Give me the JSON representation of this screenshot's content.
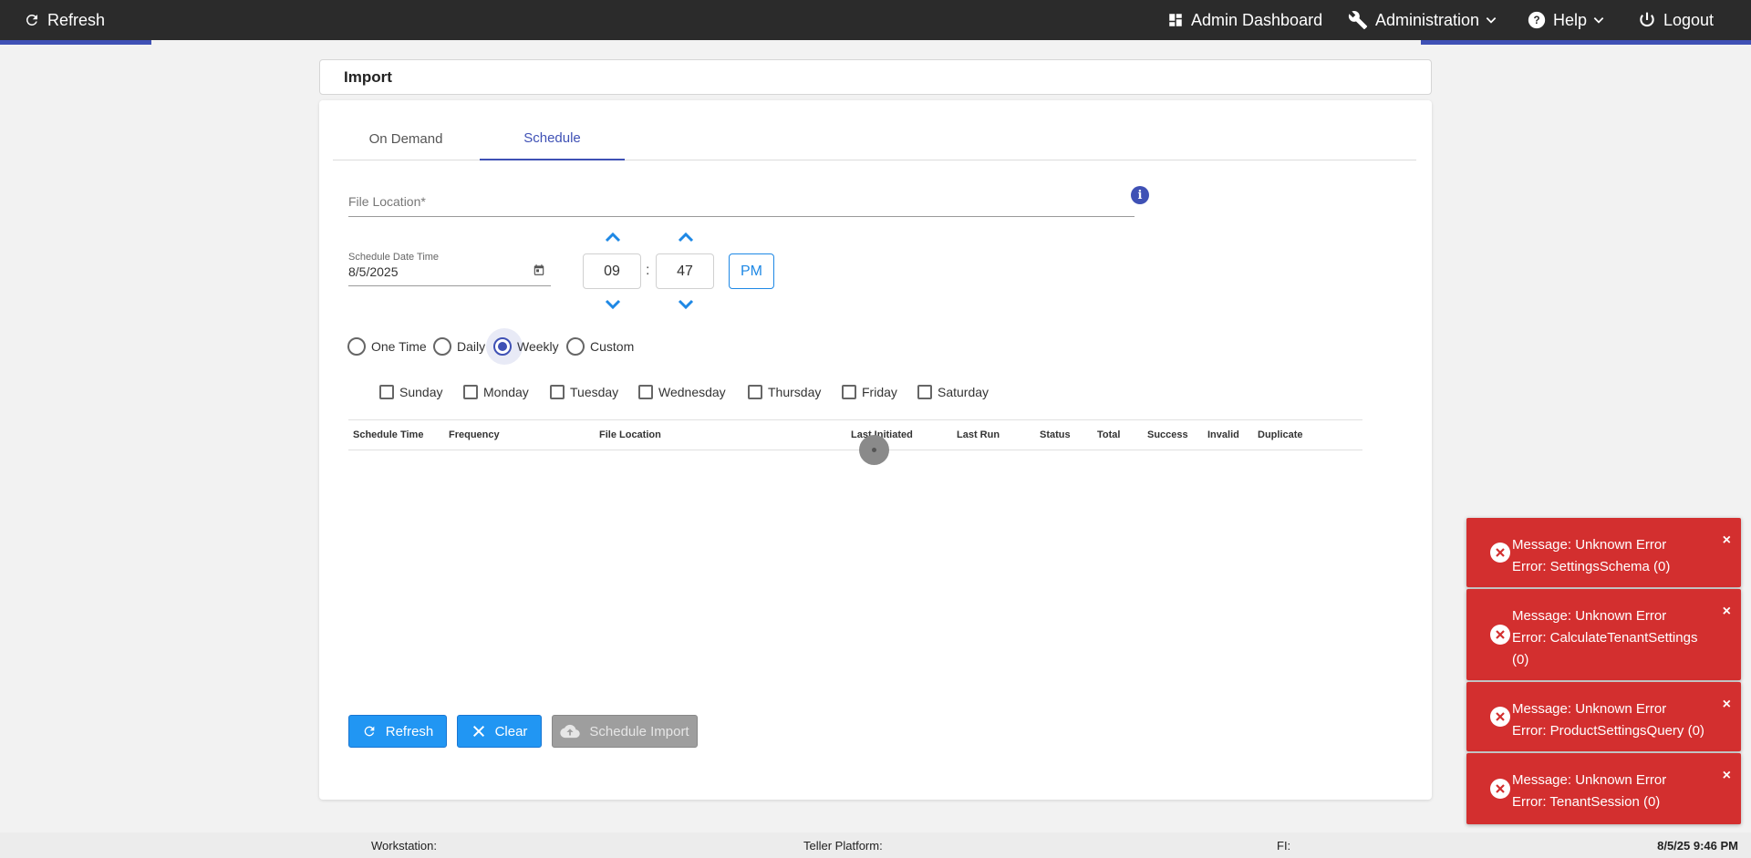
{
  "nav": {
    "refresh": "Refresh",
    "admin_dashboard": "Admin Dashboard",
    "administration": "Administration",
    "help": "Help",
    "logout": "Logout"
  },
  "colors": {
    "navbar": "#2b2b2b",
    "accent": "#3f51b5",
    "primary_button": "#2196f3",
    "error_toast": "#d32f2f"
  },
  "page": {
    "title": "Import"
  },
  "tabs": [
    {
      "label": "On Demand",
      "active": false
    },
    {
      "label": "Schedule",
      "active": true
    }
  ],
  "form": {
    "file_location_placeholder": "File Location*",
    "date_label": "Schedule Date Time",
    "date_value": "8/5/2025",
    "hour": "09",
    "minute": "47",
    "time_separator": ":",
    "ampm": "PM",
    "frequency": [
      {
        "label": "One Time",
        "checked": false
      },
      {
        "label": "Daily",
        "checked": false
      },
      {
        "label": "Weekly",
        "checked": true
      },
      {
        "label": "Custom",
        "checked": false
      }
    ],
    "days": [
      "Sunday",
      "Monday",
      "Tuesday",
      "Wednesday",
      "Thursday",
      "Friday",
      "Saturday"
    ]
  },
  "table": {
    "columns": [
      "Schedule Time",
      "Frequency",
      "File Location",
      "Last Initiated",
      "Last Run",
      "Status",
      "Total",
      "Success",
      "Invalid",
      "Duplicate"
    ]
  },
  "buttons": {
    "refresh": "Refresh",
    "clear": "Clear",
    "schedule_import": "Schedule Import"
  },
  "toasts": [
    {
      "line1": "Message: Unknown Error",
      "line2": "Error: SettingsSchema (0)",
      "close": "×"
    },
    {
      "line1": "Message: Unknown Error",
      "line2": "Error: CalculateTenantSettings (0)",
      "close": "×"
    },
    {
      "line1": "Message: Unknown Error",
      "line2": "Error: ProductSettingsQuery (0)",
      "close": "×"
    },
    {
      "line1": "Message: Unknown Error",
      "line2": "Error: TenantSession (0)",
      "close": "×"
    }
  ],
  "status_bar": {
    "workstation": "Workstation:",
    "teller_platform": "Teller Platform:",
    "fi": "FI:",
    "datetime": "8/5/25 9:46 PM"
  }
}
